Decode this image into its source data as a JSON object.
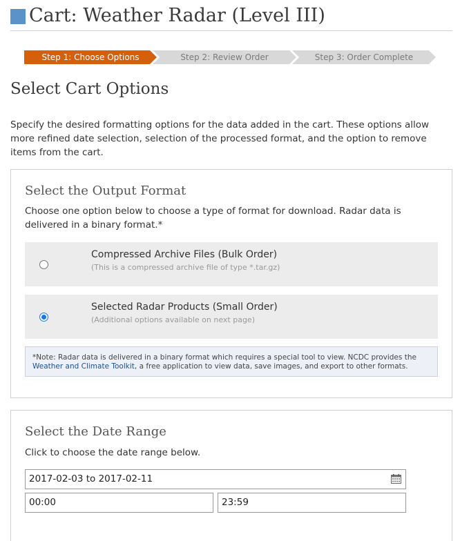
{
  "header": {
    "title": "Cart: Weather Radar (Level III)"
  },
  "steps": [
    {
      "label": "Step 1: Choose Options",
      "active": true
    },
    {
      "label": "Step 2: Review Order",
      "active": false
    },
    {
      "label": "Step 3: Order Complete",
      "active": false
    }
  ],
  "main": {
    "heading": "Select Cart Options",
    "intro": "Specify the desired formatting options for the data added in the cart. These options allow more refined date selection, selection of the processed format, and the option to remove items from the cart."
  },
  "output_format": {
    "heading": "Select the Output Format",
    "description": "Choose one option below to choose a type of format for download. Radar data is delivered in a binary format.*",
    "options": [
      {
        "title": "Compressed Archive Files (Bulk Order)",
        "subtitle": "(This is a compressed archive file of type *.tar.gz)",
        "selected": false
      },
      {
        "title": "Selected Radar Products (Small Order)",
        "subtitle": "(Additional options available on next page)",
        "selected": true
      }
    ],
    "note": {
      "before_link": "*Note: Radar data is delivered in a binary format which requires a special tool to view. NCDC provides the ",
      "link": "Weather and Climate Toolkit",
      "after_link": ", a free application to view data, save images, and export to other formats."
    }
  },
  "date_range": {
    "heading": "Select the Date Range",
    "description": "Click to choose the date range below.",
    "range_value": "2017-02-03 to 2017-02-11",
    "start_time": "00:00",
    "end_time": "23:59",
    "calendar_icon": "calendar-icon"
  },
  "colors": {
    "accent": "#d4600e",
    "brand_square": "#5b93c9",
    "link": "#1b4f8f",
    "radio": "#1a73e8"
  }
}
